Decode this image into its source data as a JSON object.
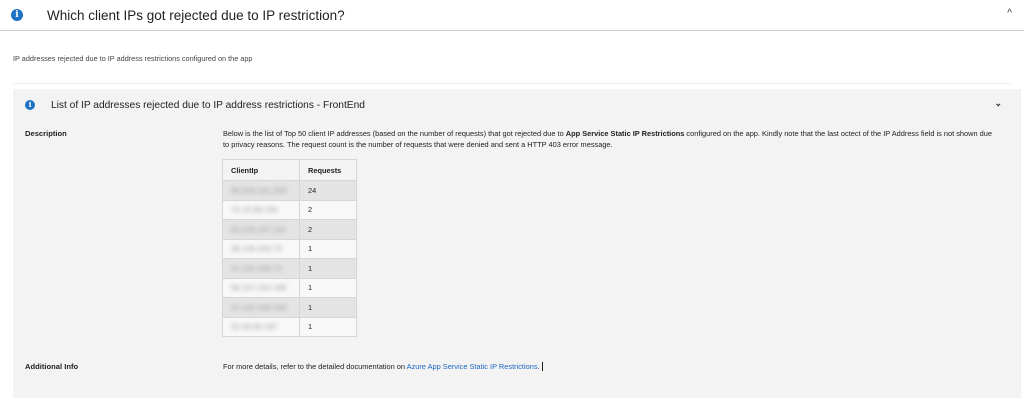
{
  "header": {
    "title": "Which client IPs got rejected due to IP restriction?",
    "info_icon": "info-icon",
    "toggle_icon": "chevron-up-icon",
    "toggle_glyph": "^"
  },
  "subtitle": "IP addresses rejected due to IP address restrictions configured on the app",
  "panel": {
    "title": "List of IP addresses rejected due to IP address restrictions - FrontEnd",
    "toggle_icon": "chevron-down-icon",
    "toggle_glyph": "⌄",
    "description_label": "Description",
    "description_part1": "Below is the list of Top 50 client IP addresses (based on the number of requests) that got rejected due to ",
    "description_bold": "App Service Static IP Restrictions",
    "description_part2": " configured on the app. Kindly note that the last octect of the IP Address field is not shown due to privacy reasons. The request count is the number of requests that were denied and sent a HTTP 403 error message.",
    "table": {
      "columns": [
        "ClientIp",
        "Requests"
      ],
      "rows": [
        {
          "ip": "99.203.101.203",
          "requests": "24"
        },
        {
          "ip": "73.15.98.240",
          "requests": "2"
        },
        {
          "ip": "52.225.107.131",
          "requests": "2"
        },
        {
          "ip": "38.126.203.75",
          "requests": "1"
        },
        {
          "ip": "37.132.100.72",
          "requests": "1"
        },
        {
          "ip": "99.107.102.186",
          "requests": "1"
        },
        {
          "ip": "37.132.100.163",
          "requests": "1"
        },
        {
          "ip": "52.69.80.187",
          "requests": "1"
        }
      ]
    },
    "additional_label": "Additional Info",
    "additional_text": "For more details, refer to the detailed documentation on ",
    "additional_link": "Azure App Service Static IP Restrictions",
    "additional_end": "."
  },
  "colors": {
    "accent": "#1d72c3",
    "link": "#1a67c2",
    "panel_bg": "#f3f3f3"
  }
}
